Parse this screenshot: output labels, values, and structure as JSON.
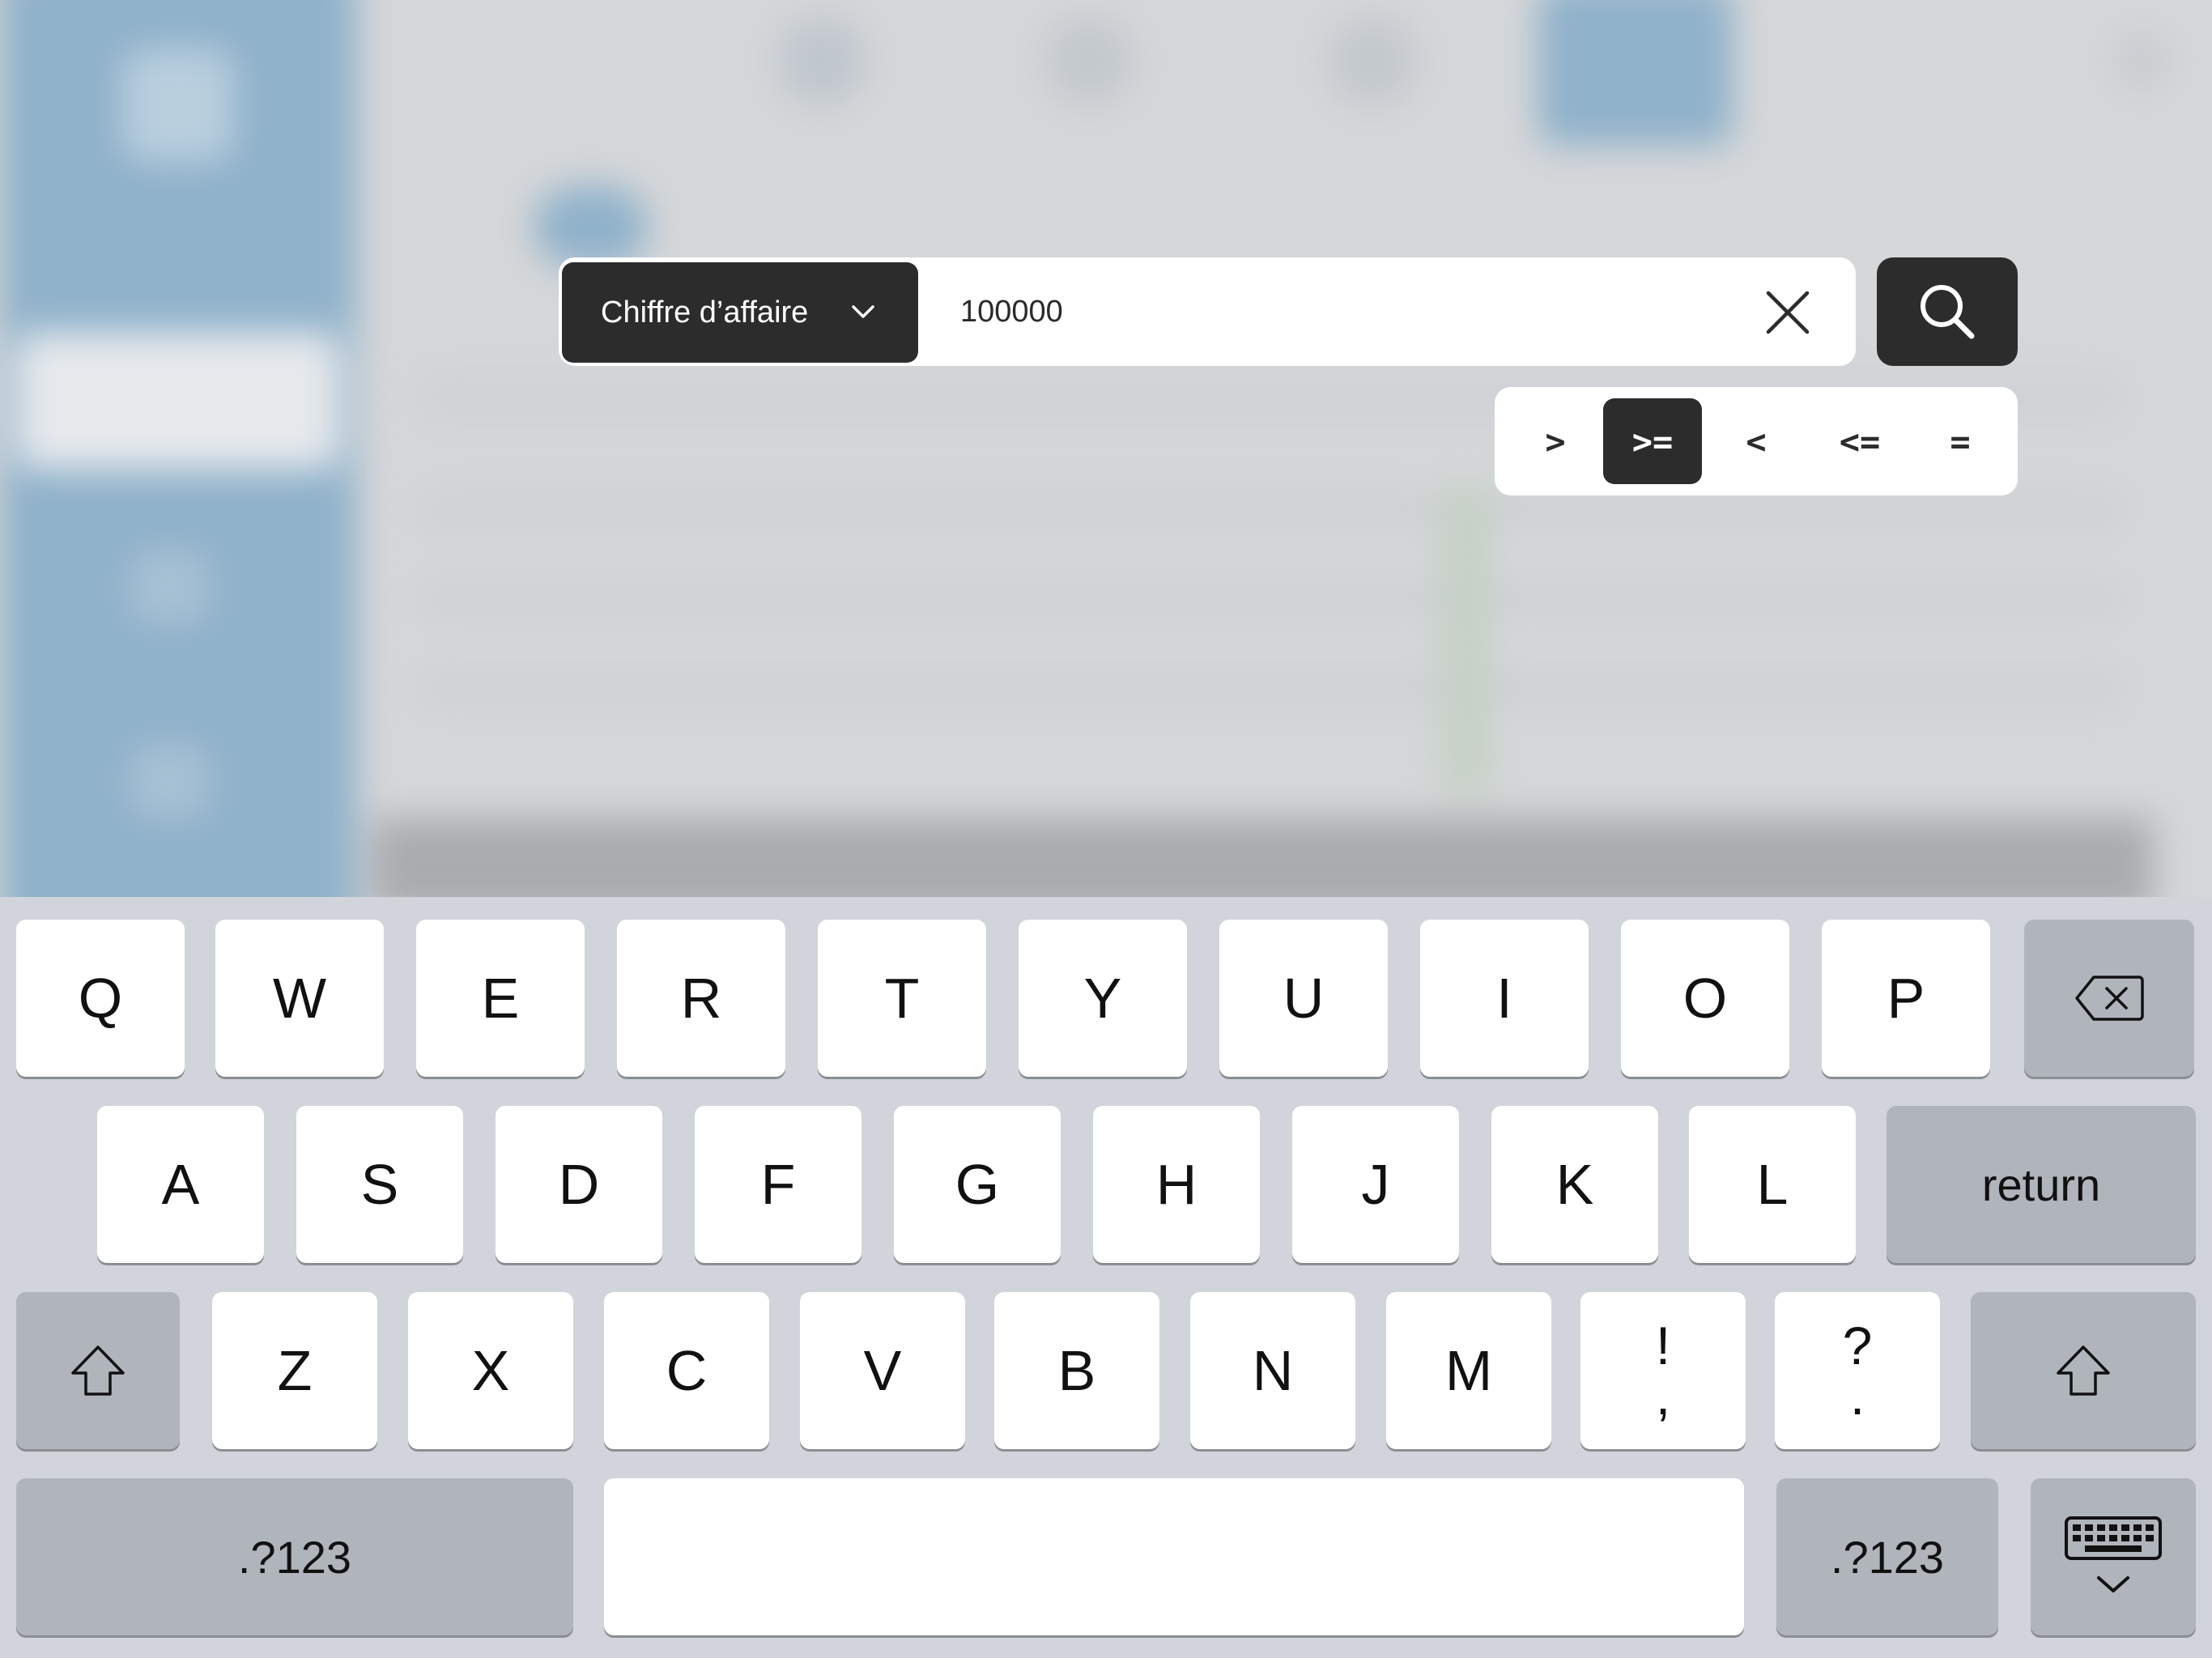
{
  "search": {
    "field_label": "Chiffre d’affaire",
    "value": "100000",
    "placeholder": ""
  },
  "operators": [
    {
      "label": ">",
      "active": false
    },
    {
      "label": ">=",
      "active": true
    },
    {
      "label": "<",
      "active": false
    },
    {
      "label": "<=",
      "active": false
    },
    {
      "label": "=",
      "active": false
    }
  ],
  "keyboard": {
    "row1": [
      "Q",
      "W",
      "E",
      "R",
      "T",
      "Y",
      "U",
      "I",
      "O",
      "P"
    ],
    "row2": [
      "A",
      "S",
      "D",
      "F",
      "G",
      "H",
      "J",
      "K",
      "L"
    ],
    "row3": [
      "Z",
      "X",
      "C",
      "V",
      "B",
      "N",
      "M"
    ],
    "punct1": {
      "top": "!",
      "bottom": ","
    },
    "punct2": {
      "top": "?",
      "bottom": "."
    },
    "return_label": "return",
    "numbers_label_left": ".?123",
    "numbers_label_right": ".?123"
  },
  "icons": [
    "chevron-down-icon",
    "clear-icon",
    "search-icon",
    "backspace-icon",
    "shift-icon",
    "keyboard-dismiss-icon"
  ],
  "colors": {
    "dark_button": "#2c2c2c",
    "keyboard_bg": "#d1d4da",
    "sidebar_blue": "#8fb1ca"
  }
}
